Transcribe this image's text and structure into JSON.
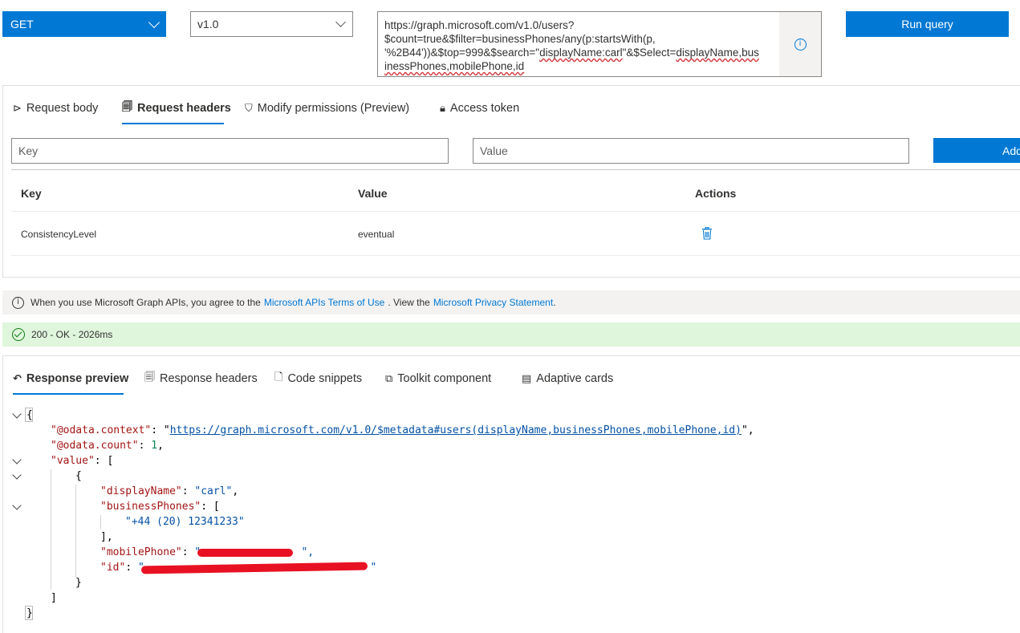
{
  "query": {
    "method": "GET",
    "version": "v1.0",
    "url_line1": "https://graph.microsoft.com/v1.0/users?",
    "url_line2": "$count=true&$filter=businessPhones/any(p:startsWith(p,",
    "url_line3a": "'%2B44'))&$top=999&$search=\"",
    "url_line3b": "displayName:carl",
    "url_line3c": "\"&$Select=",
    "url_line3d": "displayName,bus",
    "url_line4": "inessPhones,mobilePhone,id",
    "run_label": "Run query"
  },
  "request": {
    "tabs": [
      {
        "label": "Request body",
        "icon": "send-icon"
      },
      {
        "label": "Request headers",
        "icon": "document-icon"
      },
      {
        "label": "Modify permissions (Preview)",
        "icon": "shield-icon"
      },
      {
        "label": "Access token",
        "icon": "lock-icon"
      }
    ],
    "key_placeholder": "Key",
    "value_placeholder": "Value",
    "add_label": "Add",
    "table": {
      "headers": [
        "Key",
        "Value",
        "Actions"
      ],
      "rows": [
        {
          "key": "ConsistencyLevel",
          "value": "eventual",
          "action_icon": "trash-icon"
        }
      ]
    }
  },
  "terms": {
    "prefix": "When you use Microsoft Graph APIs, you agree to the",
    "link1": "Microsoft APIs Terms of Use",
    "middle": ". View the",
    "link2": "Microsoft Privacy Statement",
    "suffix": "."
  },
  "status": {
    "text": "200 - OK - 2026ms",
    "color": "#107c10"
  },
  "response": {
    "tabs": [
      {
        "label": "Response preview",
        "icon": "undo-icon"
      },
      {
        "label": "Response headers",
        "icon": "document-icon"
      },
      {
        "label": "Code snippets",
        "icon": "code-file-icon"
      },
      {
        "label": "Toolkit component",
        "icon": "component-icon"
      },
      {
        "label": "Adaptive cards",
        "icon": "card-icon"
      }
    ],
    "json": {
      "context_key": "\"@odata.context\"",
      "context_val": "https://graph.microsoft.com/v1.0/$metadata#users(displayName,businessPhones,mobilePhone,id)",
      "count_key": "\"@odata.count\"",
      "count_val": "1",
      "value_key": "\"value\"",
      "displayName_key": "\"displayName\"",
      "displayName_val": "\"carl\"",
      "businessPhones_key": "\"businessPhones\"",
      "phone_val": "\"+44 (20) 12341233\"",
      "mobilePhone_key": "\"mobilePhone\"",
      "id_key": "\"id\""
    }
  },
  "colors": {
    "accent": "#0078d4",
    "status_bg": "#dff6dd",
    "redaction": "#e81123"
  }
}
